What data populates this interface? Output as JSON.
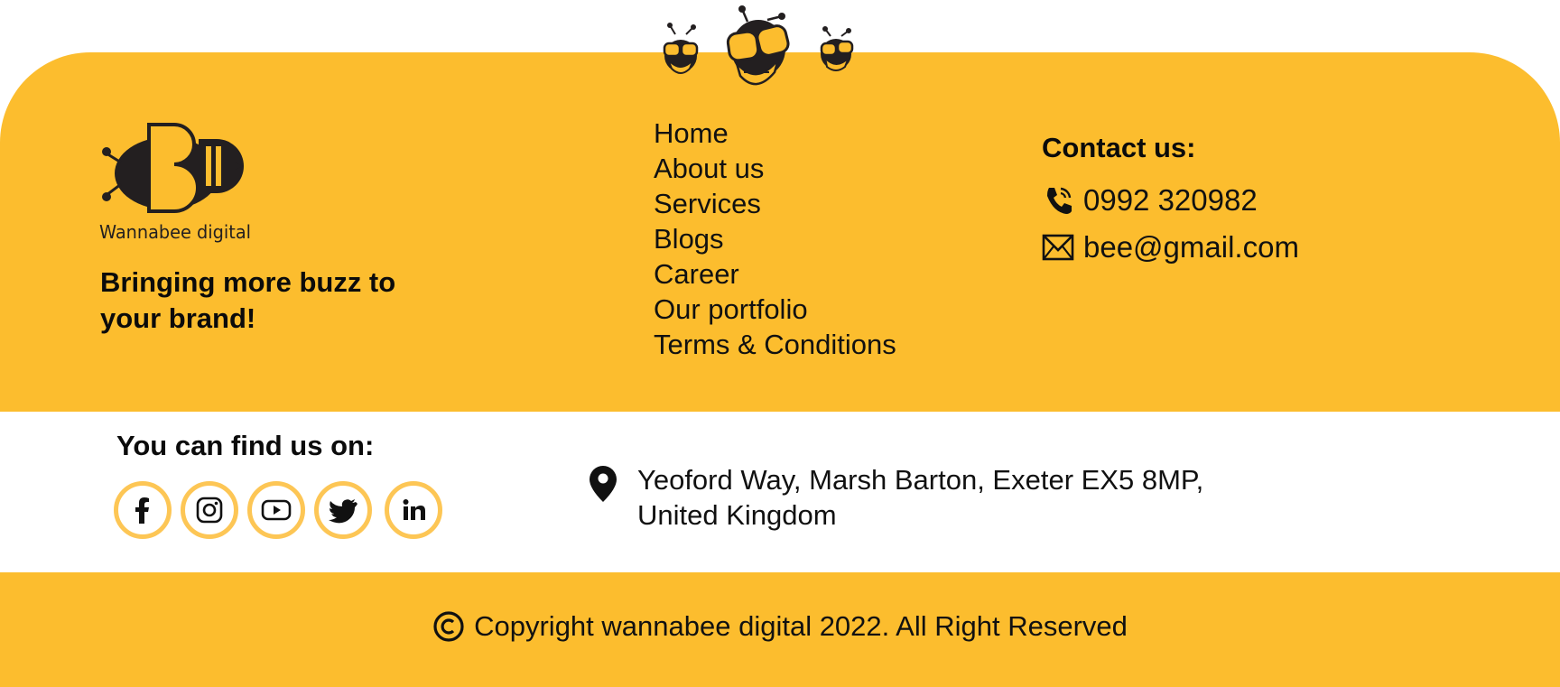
{
  "brand": {
    "logo_text": "Wannabee digital",
    "tagline": "Bringing more buzz to your brand!"
  },
  "nav": {
    "items": [
      {
        "label": "Home"
      },
      {
        "label": "About us"
      },
      {
        "label": "Services"
      },
      {
        "label": "Blogs"
      },
      {
        "label": "Career"
      },
      {
        "label": "Our portfolio"
      },
      {
        "label": "Terms & Conditions"
      }
    ]
  },
  "contact": {
    "title": "Contact us:",
    "phone": "0992 320982",
    "phone_icon": "phone-icon",
    "email": "bee@gmail.com",
    "email_icon": "mail-icon"
  },
  "social": {
    "title": "You can find us on:",
    "items": [
      {
        "icon": "facebook-icon"
      },
      {
        "icon": "instagram-icon"
      },
      {
        "icon": "youtube-icon"
      },
      {
        "icon": "twitter-icon"
      },
      {
        "icon": "linkedin-icon"
      }
    ]
  },
  "address": {
    "icon": "location-pin-icon",
    "line1": "Yeoford Way, Marsh Barton, Exeter EX5 8MP,",
    "line2": "United Kingdom"
  },
  "footer": {
    "copyright_icon": "copyright-icon",
    "copyright": "Copyright wannabee digital 2022. All Right Reserved"
  },
  "colors": {
    "brand_yellow": "#fcbd2e",
    "social_ring": "#fdc655",
    "text_dark": "#111111",
    "background": "#ffffff"
  }
}
